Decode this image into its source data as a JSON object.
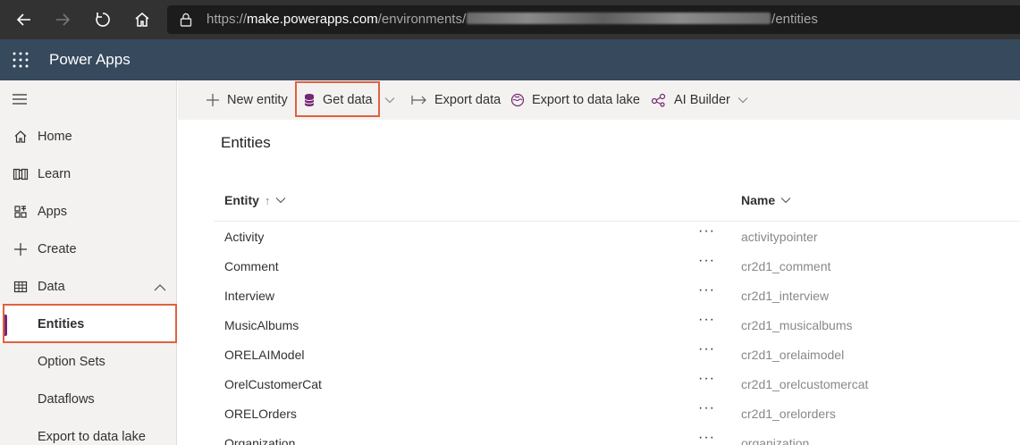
{
  "browser": {
    "url_scheme": "https://",
    "url_host": "make.powerapps.com",
    "url_path_start": "/environments/",
    "url_path_end": "/entities"
  },
  "app": {
    "title": "Power Apps"
  },
  "sidebar": {
    "items": [
      {
        "label": "Home",
        "icon": "home-icon"
      },
      {
        "label": "Learn",
        "icon": "book-icon"
      },
      {
        "label": "Apps",
        "icon": "apps-icon"
      },
      {
        "label": "Create",
        "icon": "plus-icon"
      },
      {
        "label": "Data",
        "icon": "table-icon"
      },
      {
        "label": "Entities",
        "selected": true
      },
      {
        "label": "Option Sets"
      },
      {
        "label": "Dataflows"
      },
      {
        "label": "Export to data lake"
      }
    ]
  },
  "toolbar": {
    "new_entity": "New entity",
    "get_data": "Get data",
    "export_data": "Export data",
    "export_lake": "Export to data lake",
    "ai_builder": "AI Builder"
  },
  "content": {
    "title": "Entities",
    "columns": {
      "entity": "Entity",
      "entity_sort": "↑",
      "name": "Name"
    },
    "rows": [
      {
        "entity": "Activity",
        "actions": "···",
        "name": "activitypointer"
      },
      {
        "entity": "Comment",
        "actions": "···",
        "name": "cr2d1_comment"
      },
      {
        "entity": "Interview",
        "actions": "···",
        "name": "cr2d1_interview"
      },
      {
        "entity": "MusicAlbums",
        "actions": "···",
        "name": "cr2d1_musicalbums"
      },
      {
        "entity": "ORELAIModel",
        "actions": "···",
        "name": "cr2d1_orelaimodel"
      },
      {
        "entity": "OrelCustomerCat",
        "actions": "···",
        "name": "cr2d1_orelcustomercat"
      },
      {
        "entity": "ORELOrders",
        "actions": "···",
        "name": "cr2d1_orelorders"
      },
      {
        "entity": "Organization",
        "actions": "···",
        "name": "organization"
      }
    ]
  },
  "colors": {
    "header_bg": "#36495d",
    "accent": "#742774",
    "highlight": "#e0613f"
  }
}
